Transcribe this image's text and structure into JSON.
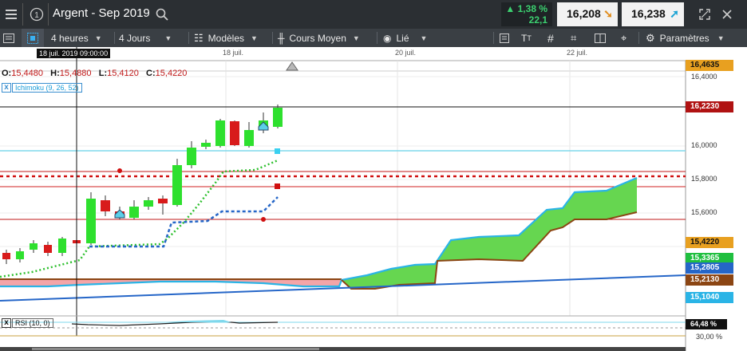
{
  "header": {
    "menu_icon": "hamburger-menu-icon",
    "info_icon": "info-circle-icon",
    "title": "Argent - Sep 2019",
    "search_icon": "search-icon",
    "change_pct": "▲ 1,38 %",
    "change_abs": "22,1",
    "sell_price": "16,208",
    "buy_price": "16,238",
    "expand_icon": "expand-icon",
    "close_icon": "close-icon",
    "colors": {
      "up": "#3cd070",
      "sell_arrow": "#e08b1a",
      "buy_arrow": "#1aa3d4"
    }
  },
  "toolbar": {
    "timeframe": "4 heures",
    "period": "4 Jours",
    "templates": "Modèles",
    "price_type": "Cours Moyen",
    "link": "Lié",
    "settings": "Paramètres",
    "icons": [
      "panel-list-icon",
      "crosshair-select-icon",
      "templates-icon",
      "candle-type-icon",
      "eye-icon",
      "indicator-panel-icon",
      "text-tool-icon",
      "grid-icon",
      "draw-tool-icon",
      "layout-icon",
      "cursor-target-icon",
      "gear-icon"
    ]
  },
  "chart": {
    "date_tooltip": "18 juil. 2019 09:00:00",
    "date_labels": [
      "18 juil.",
      "20 juil.",
      "22 juil."
    ],
    "ohlc": {
      "o_label": "O:",
      "o": "15,4480",
      "h_label": "H:",
      "h": "15,4880",
      "l_label": "L:",
      "l": "15,4120",
      "c_label": "C:",
      "c": "15,4220"
    },
    "indicator": {
      "close": "x",
      "name": "Ichimoku (9, 26, 52)"
    },
    "rsi": {
      "close": "x",
      "name": "RSI (10, 0)",
      "value": "64,48 %",
      "tick": "30,00 %"
    },
    "price_ticks": [
      "16,4000",
      "16,0000",
      "15,8000",
      "15,6000"
    ],
    "price_tags": [
      {
        "value": "16,4635",
        "bg": "#e8a020",
        "fg": "#111"
      },
      {
        "value": "16,2230",
        "bg": "#b01212",
        "fg": "#fff"
      },
      {
        "value": "15,4220",
        "bg": "#e8a020",
        "fg": "#111"
      },
      {
        "value": "15,3365",
        "bg": "#1fbf3f",
        "fg": "#fff"
      },
      {
        "value": "15,2805",
        "bg": "#2566c8",
        "fg": "#fff"
      },
      {
        "value": "15,2130",
        "bg": "#8b4513",
        "fg": "#fff"
      },
      {
        "value": "15,1040",
        "bg": "#2ab4e6",
        "fg": "#fff"
      }
    ]
  }
}
